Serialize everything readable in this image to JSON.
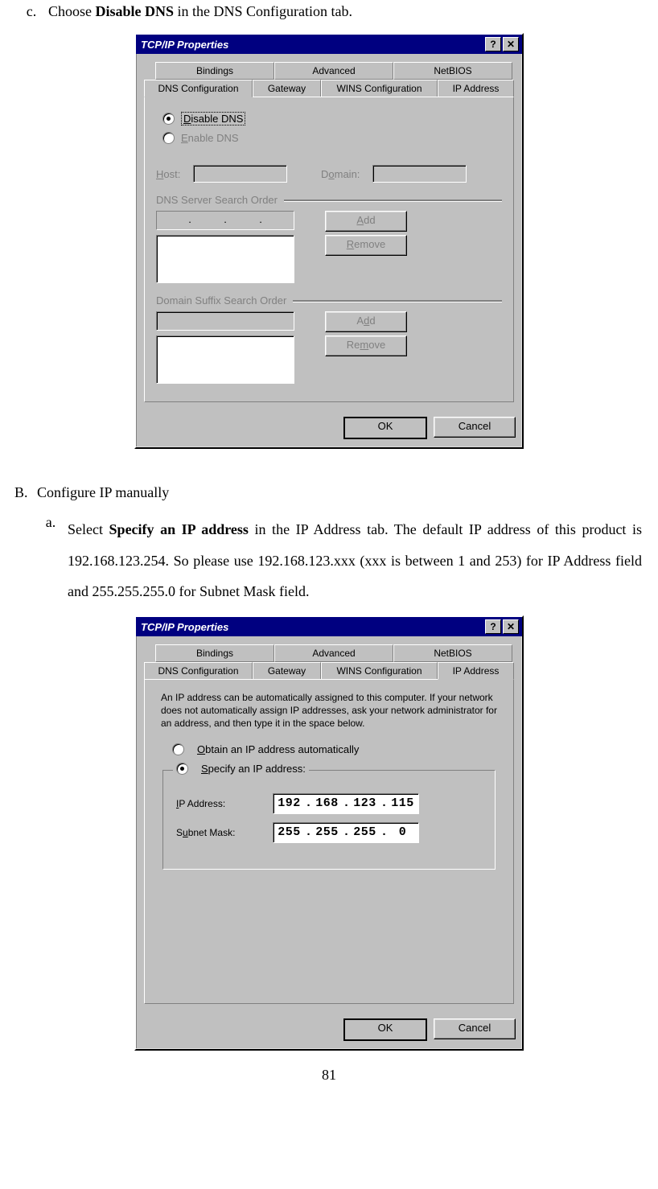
{
  "line_c": {
    "marker": "c.",
    "pre": "Choose ",
    "bold": "Disable DNS",
    "post": " in the DNS Configuration tab."
  },
  "dialog1": {
    "title": "TCP/IP Properties",
    "help_btn": "?",
    "close_btn": "✕",
    "tabs_row1": [
      "Bindings",
      "Advanced",
      "NetBIOS"
    ],
    "tabs_row2": [
      "DNS Configuration",
      "Gateway",
      "WINS Configuration",
      "IP Address"
    ],
    "active_tab": "DNS Configuration",
    "radio_disable": "Disable DNS",
    "radio_enable": "Enable DNS",
    "host_label": "Host:",
    "domain_label": "Domain:",
    "group_dns_order": "DNS Server Search Order",
    "group_suffix": "Domain Suffix Search Order",
    "btn_add": "Add",
    "btn_remove": "Remove",
    "btn_ok": "OK",
    "btn_cancel": "Cancel"
  },
  "section_B": {
    "marker": "B.",
    "text": "Configure IP manually"
  },
  "sub_a": {
    "marker": "a.",
    "pre": "Select ",
    "bold": "Specify an IP address",
    "post": " in the IP Address tab. The default IP address of this product is 192.168.123.254. So please use 192.168.123.xxx (xxx is between 1 and 253) for IP Address field and 255.255.255.0 for Subnet Mask field."
  },
  "dialog2": {
    "title": "TCP/IP Properties",
    "help_btn": "?",
    "close_btn": "✕",
    "tabs_row1": [
      "Bindings",
      "Advanced",
      "NetBIOS"
    ],
    "tabs_row2": [
      "DNS Configuration",
      "Gateway",
      "WINS Configuration",
      "IP Address"
    ],
    "active_tab": "IP Address",
    "desc": "An IP address can be automatically assigned to this computer. If your network does not automatically assign IP addresses, ask your network administrator for an address, and then type it in the space below.",
    "radio_obtain": "Obtain an IP address automatically",
    "radio_specify": "Specify an IP address:",
    "ip_label": "IP Address:",
    "ip_value": [
      "192",
      "168",
      "123",
      "115"
    ],
    "mask_label": "Subnet Mask:",
    "mask_value": [
      "255",
      "255",
      "255",
      "  0"
    ],
    "btn_ok": "OK",
    "btn_cancel": "Cancel"
  },
  "page_number": "81"
}
